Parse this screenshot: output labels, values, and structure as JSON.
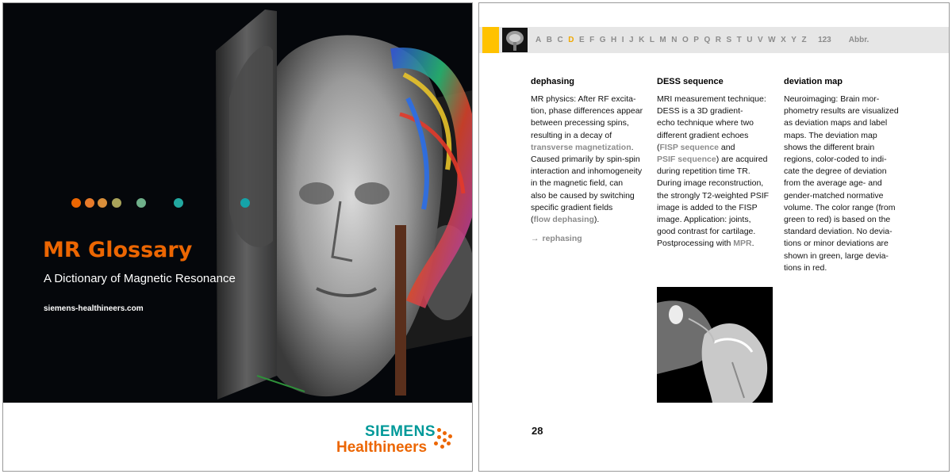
{
  "cover": {
    "title": "MR Glossary",
    "subtitle": "A Dictionary of Magnetic Resonance",
    "url": "siemens-healthineers.com",
    "dot_colors": [
      "#ec6602",
      "#e87a2a",
      "#d98e3a",
      "#a9a35a",
      "#6fb08a",
      "#22a8a0",
      "#15a3a8"
    ],
    "brand": {
      "line1": "SIEMENS",
      "line2": "Healthineers",
      "teal": "#009999",
      "orange": "#ec6602"
    }
  },
  "glossary": {
    "alphabet": [
      "A",
      "B",
      "C",
      "D",
      "E",
      "F",
      "G",
      "H",
      "I",
      "J",
      "K",
      "L",
      "M",
      "N",
      "O",
      "P",
      "Q",
      "R",
      "S",
      "T",
      "U",
      "V",
      "W",
      "X",
      "Y",
      "Z"
    ],
    "active_letter": "D",
    "extra_tabs": [
      "123",
      "Abbr."
    ],
    "accent_color": "#ffc200",
    "entries": [
      {
        "term": "dephasing",
        "body": [
          {
            "t": "MR physics: After RF excita-"
          },
          {
            "t": "tion, phase differences appear"
          },
          {
            "t": "between precessing spins,"
          },
          {
            "t": "resulting in a decay of"
          },
          {
            "t": "transverse magnetization",
            "link": true,
            "after": "."
          },
          {
            "t": "Caused primarily by spin-spin"
          },
          {
            "t": "interaction and inhomogeneity"
          },
          {
            "t": "in the magnetic field, can"
          },
          {
            "t": "also be caused by switching"
          },
          {
            "t": "specific gradient fields"
          },
          {
            "before": "(",
            "t": "flow dephasing",
            "link": true,
            "after": ")."
          }
        ],
        "see_also": "rephasing"
      },
      {
        "term": "DESS sequence",
        "body": [
          {
            "t": "MRI measurement technique:"
          },
          {
            "t": "DESS is a 3D gradient-"
          },
          {
            "t": "echo technique where two"
          },
          {
            "t": "different gradient echoes"
          },
          {
            "before": "(",
            "t": "FISP sequence",
            "link": true,
            "after": " and"
          },
          {
            "t": "PSIF sequence",
            "link": true,
            "after": ") are acquired"
          },
          {
            "t": "during repetition time TR."
          },
          {
            "t": "During image reconstruction,"
          },
          {
            "t": "the strongly T2-weighted PSIF"
          },
          {
            "t": "image is added to the FISP"
          },
          {
            "t": "image. Application: joints,"
          },
          {
            "t": "good contrast for cartilage."
          },
          {
            "before": "Postprocessing with ",
            "t": "MPR",
            "link": true,
            "after": "."
          }
        ]
      },
      {
        "term": "deviation map",
        "body": [
          {
            "t": "Neuroimaging: Brain mor-"
          },
          {
            "t": "phometry results are visualized"
          },
          {
            "t": "as deviation maps and label"
          },
          {
            "t": "maps. The deviation map"
          },
          {
            "t": "shows the different brain"
          },
          {
            "t": "regions, color-coded to indi-"
          },
          {
            "t": "cate the degree of deviation"
          },
          {
            "t": "from the average age- and"
          },
          {
            "t": "gender-matched normative"
          },
          {
            "t": "volume. The color range (from"
          },
          {
            "t": "green to red) is based on the"
          },
          {
            "t": "standard deviation. No devia-"
          },
          {
            "t": "tions or minor deviations are"
          },
          {
            "t": "shown in green, large devia-"
          },
          {
            "t": "tions in red."
          }
        ]
      }
    ],
    "page_number": "28"
  }
}
